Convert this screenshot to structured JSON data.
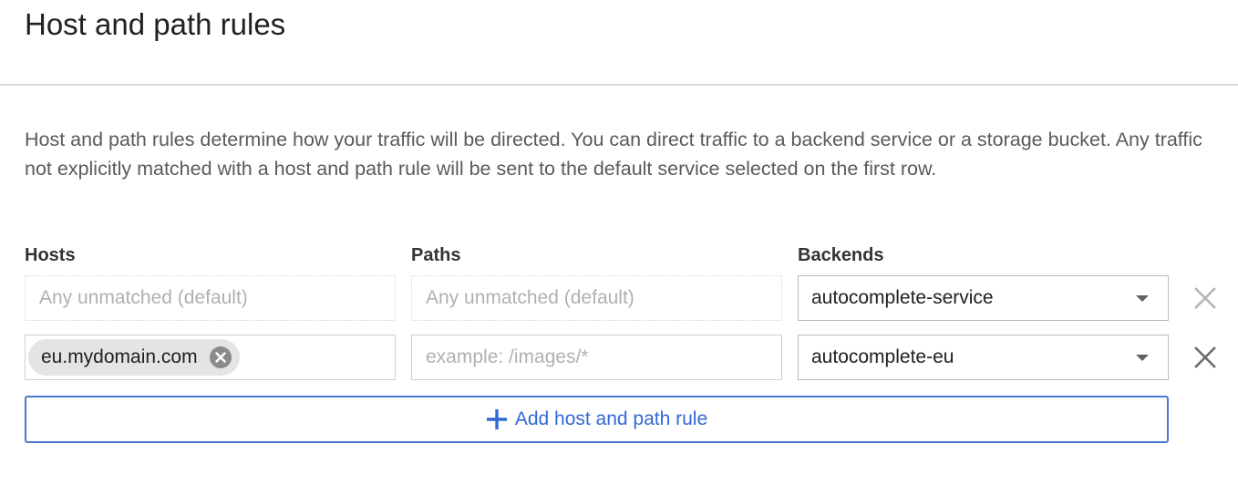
{
  "page": {
    "title": "Host and path rules",
    "description": "Host and path rules determine how your traffic will be directed. You can direct traffic to a backend service or a storage bucket. Any traffic not explicitly matched with a host and path rule will be sent to the default service selected on the first row."
  },
  "columns": {
    "hosts": "Hosts",
    "paths": "Paths",
    "backends": "Backends"
  },
  "rules": [
    {
      "host_placeholder": "Any unmatched (default)",
      "path_placeholder": "Any unmatched (default)",
      "backend": "autocomplete-service",
      "remove_icon": "close-icon"
    },
    {
      "host_chip": "eu.mydomain.com",
      "path_placeholder": "example: /images/*",
      "backend": "autocomplete-eu",
      "remove_icon": "close-icon"
    }
  ],
  "actions": {
    "add_rule_label": "Add host and path rule",
    "add_icon": "plus-icon"
  },
  "colors": {
    "accent": "#3367d6",
    "border_accent": "#4a78d2",
    "chip_bg": "#e4e4e4"
  }
}
